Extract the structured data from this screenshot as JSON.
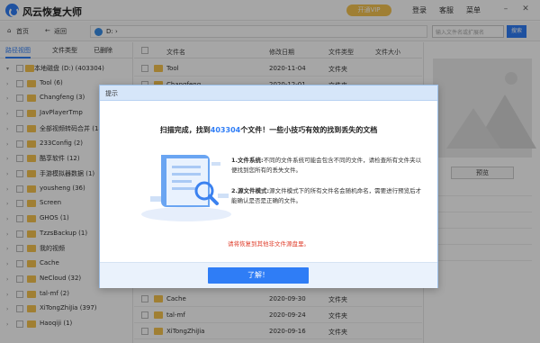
{
  "app": {
    "title": "风云恢复大师",
    "vip_label": "开通VIP",
    "login": "登录",
    "service": "客服",
    "menu": "菜单"
  },
  "toolbar": {
    "home": "首页",
    "back": "返回",
    "path": "D: ›",
    "search_placeholder": "输入文件名或扩展名",
    "search_button": "搜索"
  },
  "left_tabs": [
    "路径视图",
    "文件类型",
    "已删除"
  ],
  "tree": {
    "root": "本地磁盘 (D:) (403304)",
    "items": [
      "Tool (6)",
      "Changfeng (3)",
      "JavPlayerTmp",
      "全部视频转码合并 (18)",
      "233Config (2)",
      "酷享软件 (12)",
      "手游模拟器数据 (1)",
      "yousheng (36)",
      "Screen",
      "GHOS (1)",
      "TzzsBackup (1)",
      "我的视频",
      "Cache",
      "NeCloud (32)",
      "tal-mf (2)",
      "XiTongZhiJia (397)",
      "Haoqiji (1)"
    ]
  },
  "columns": [
    "文件名",
    "修改日期",
    "文件类型",
    "文件大小"
  ],
  "files": [
    {
      "name": "Tool",
      "date": "2020-11-04",
      "type": "文件夹"
    },
    {
      "name": "Changfeng",
      "date": "2020-12-01",
      "type": "文件夹"
    },
    {
      "name": "Cache",
      "date": "2020-09-30",
      "type": "文件夹"
    },
    {
      "name": "tal-mf",
      "date": "2020-09-24",
      "type": "文件夹"
    },
    {
      "name": "XiTongZhiJia",
      "date": "2020-09-16",
      "type": "文件夹"
    }
  ],
  "right_panel": {
    "preview_button": "预览"
  },
  "dialog": {
    "title": "提示",
    "message_prefix": "扫描完成，找到",
    "message_count": "403304",
    "message_suffix": "个文件！一些小技巧有效的找到丢失的文档",
    "tip1_title": "1.文件系统:",
    "tip1_body": "不同的文件系统可能会包含不同的文件，请检查所有文件夹以便找到您所有的丢失文件。",
    "tip2_title": "2.源文件模式:",
    "tip2_body": "源文件模式下的所有文件名会随机命名，需要进行预览后才能确认是否是正确的文件。",
    "warning": "请将恢复到其他非文件源盘里。",
    "ok_button": "了解！"
  },
  "colors": {
    "accent": "#2f7df6",
    "folder": "#f6c44f",
    "vip": "#f5c451",
    "warning": "#e0412f"
  }
}
